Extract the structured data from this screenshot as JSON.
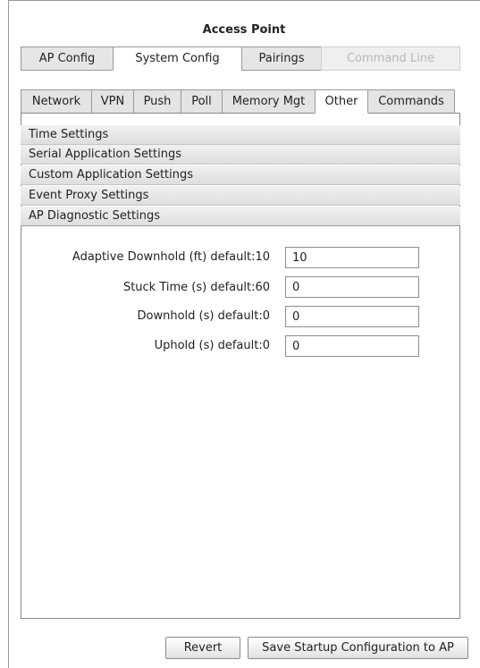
{
  "window": {
    "title": "Access Point"
  },
  "top_tabs": [
    {
      "label": "AP Config"
    },
    {
      "label": "System Config"
    },
    {
      "label": "Pairings"
    },
    {
      "label": "Command Line"
    }
  ],
  "sub_tabs": [
    {
      "label": "Network"
    },
    {
      "label": "VPN"
    },
    {
      "label": "Push"
    },
    {
      "label": "Poll"
    },
    {
      "label": "Memory Mgt"
    },
    {
      "label": "Other"
    },
    {
      "label": "Commands"
    }
  ],
  "sections": [
    {
      "label": "Time Settings"
    },
    {
      "label": "Serial Application Settings"
    },
    {
      "label": "Custom Application Settings"
    },
    {
      "label": "Event Proxy Settings"
    },
    {
      "label": "AP Diagnostic Settings"
    }
  ],
  "fields": [
    {
      "label": "Adaptive Downhold (ft) default:10",
      "value": "10"
    },
    {
      "label": "Stuck Time (s) default:60",
      "value": "0"
    },
    {
      "label": "Downhold (s) default:0",
      "value": "0"
    },
    {
      "label": "Uphold (s) default:0",
      "value": "0"
    }
  ],
  "buttons": {
    "revert": "Revert",
    "save": "Save Startup Configuration to AP"
  }
}
